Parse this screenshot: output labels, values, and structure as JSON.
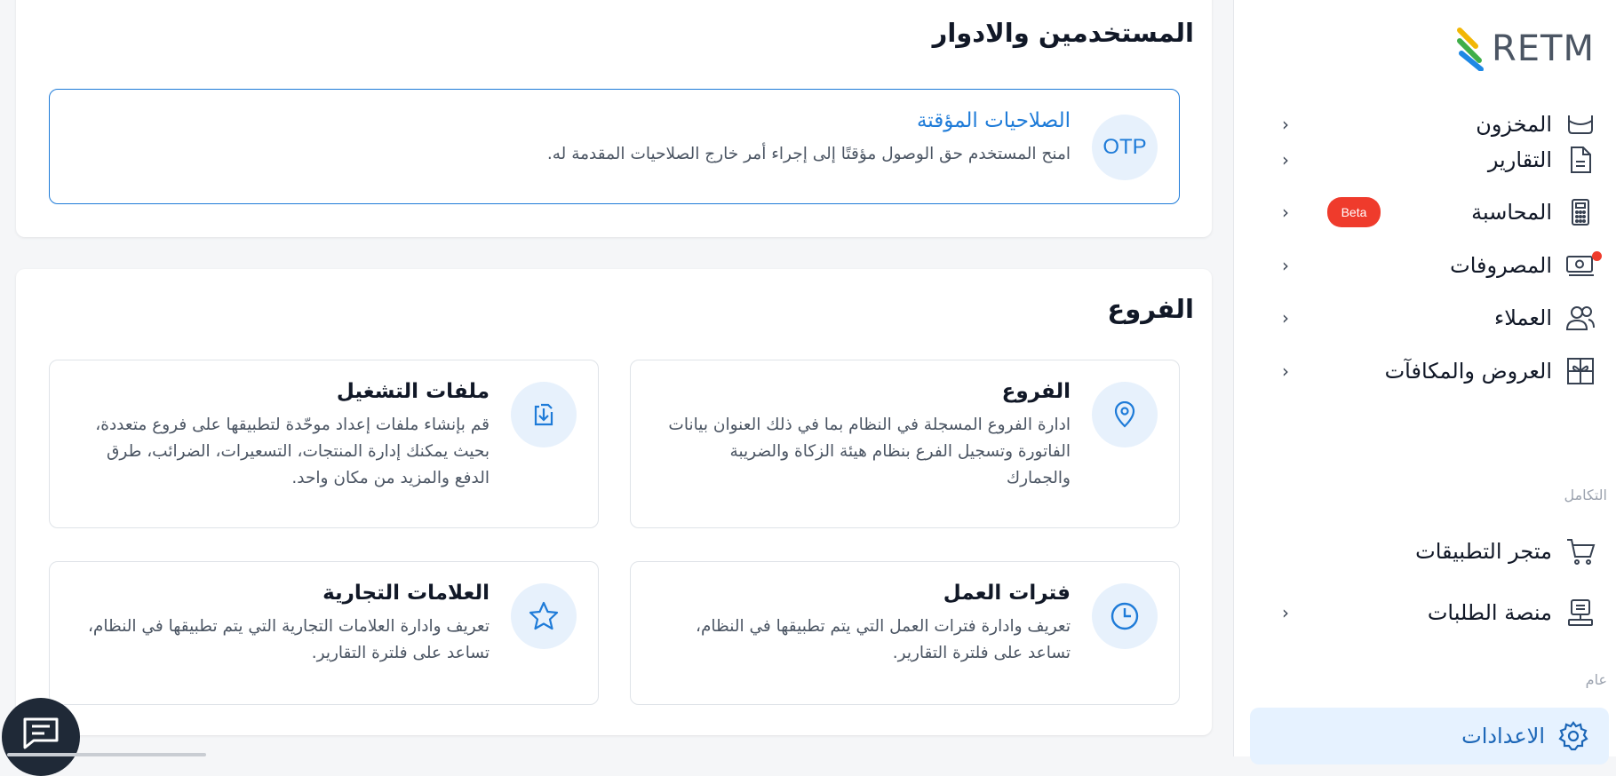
{
  "brand": {
    "logo_text": "RETM"
  },
  "sidebar": {
    "items": [
      {
        "label": "المخزون",
        "icon": "inventory-icon"
      },
      {
        "label": "التقارير",
        "icon": "report-icon"
      },
      {
        "label": "المحاسبة",
        "icon": "calculator-icon",
        "badge": "Beta"
      },
      {
        "label": "المصروفات",
        "icon": "money-icon"
      },
      {
        "label": "العملاء",
        "icon": "users-icon"
      },
      {
        "label": "العروض والمكافآت",
        "icon": "gift-icon"
      }
    ],
    "integration_label": "التكامل",
    "integration_items": [
      {
        "label": "متجر التطبيقات",
        "icon": "cart-icon"
      },
      {
        "label": "منصة الطلبات",
        "icon": "orders-platform-icon"
      }
    ],
    "general_label": "عام",
    "settings_label": "الاعدادات"
  },
  "users_roles": {
    "title": "المستخدمين والادوار",
    "otp": {
      "icon_text": "OTP",
      "title": "الصلاحيات المؤقتة",
      "description": "امنح المستخدم حق الوصول مؤقتًا إلى إجراء أمر خارج الصلاحيات المقدمة له."
    }
  },
  "branches": {
    "title": "الفروع",
    "tiles": [
      {
        "title": "الفروع",
        "description": "ادارة الفروع المسجلة في النظام بما في ذلك العنوان بيانات الفاتورة وتسجيل الفرع بنظام هيئة الزكاة والضريبة والجمارك",
        "icon": "location-pin-icon"
      },
      {
        "title": "ملفات التشغيل",
        "description": "قم بإنشاء ملفات إعداد موحّدة لتطبيقها على فروع متعددة، بحيث يمكنك إدارة المنتجات، التسعيرات، الضرائب، طرق الدفع والمزيد من مكان واحد.",
        "icon": "file-download-icon"
      },
      {
        "title": "فترات العمل",
        "description": "تعريف وادارة فترات العمل التي يتم تطبيقها في النظام، تساعد على فلترة التقارير.",
        "icon": "clock-icon"
      },
      {
        "title": "العلامات التجارية",
        "description": "تعريف وادارة العلامات التجارية التي يتم تطبيقها في النظام، تساعد على فلترة التقارير.",
        "icon": "star-icon"
      }
    ]
  },
  "colors": {
    "accent": "#1e7bd8",
    "badge": "#ef3b2c",
    "active_bg": "#e6f2ff"
  }
}
